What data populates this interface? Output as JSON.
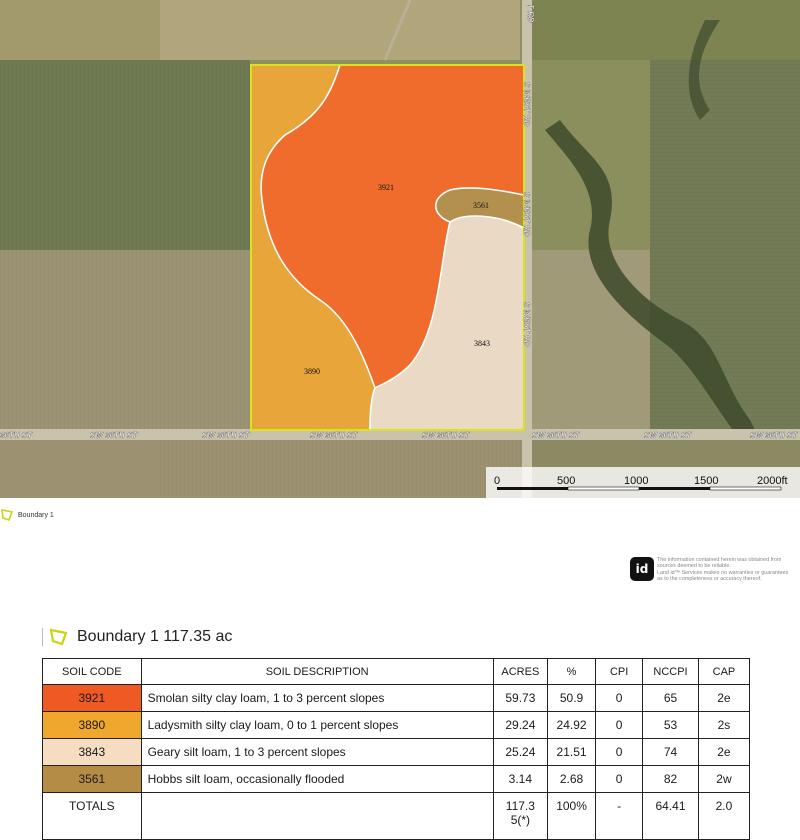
{
  "map": {
    "road_labels": {
      "north_rd": "T RD",
      "west_rd_1": "S WEST RD",
      "west_rd_2": "S WEST RD",
      "west_rd_3": "S WEST RD",
      "st_1": "36TH ST",
      "st_2": "SW 36TH ST",
      "st_3": "SW 36TH ST",
      "st_4": "SW 36TH ST",
      "st_5": "SW 36TH ST",
      "st_6": "SW 36TH ST",
      "st_7": "SW 36TH ST",
      "st_8": "SW 36TH ST"
    },
    "soil_labels": {
      "s3921": "3921",
      "s3561": "3561",
      "s3843": "3843",
      "s3890": "3890"
    },
    "scale": {
      "t0": "0",
      "t500": "500",
      "t1000": "1000",
      "t1500": "1500",
      "t2000": "2000ft"
    },
    "colors": {
      "boundary": "#d9e21a",
      "s3921": "#ef6c2c",
      "s3890": "#e8a53a",
      "s3843": "#ead9c4",
      "s3561": "#b4904f"
    }
  },
  "legend": {
    "label": "Boundary 1"
  },
  "disclaimer": {
    "logo": "id",
    "line1": "The information contained herein was obtained from",
    "line2": "sources deemed to be reliable.",
    "line3": "Land id™ Services makes no warranties or guarantees",
    "line4": "as to the completeness or accuracy thereof."
  },
  "summary": {
    "title": "Boundary 1 117.35 ac"
  },
  "table": {
    "headers": {
      "code": "SOIL CODE",
      "desc": "SOIL DESCRIPTION",
      "acres": "ACRES",
      "pct": "%",
      "cpi": "CPI",
      "nccpi": "NCCPI",
      "cap": "CAP"
    },
    "rows": [
      {
        "code": "3921",
        "color": "#ef5a24",
        "desc": "Smolan silty clay loam, 1 to 3 percent slopes",
        "acres": "59.73",
        "pct": "50.9",
        "cpi": "0",
        "nccpi": "65",
        "cap": "2e"
      },
      {
        "code": "3890",
        "color": "#f0a72e",
        "desc": "Ladysmith silty clay loam, 0 to 1 percent slopes",
        "acres": "29.24",
        "pct": "24.92",
        "cpi": "0",
        "nccpi": "53",
        "cap": "2s"
      },
      {
        "code": "3843",
        "color": "#f6dcc0",
        "desc": "Geary silt loam, 1 to 3 percent slopes",
        "acres": "25.24",
        "pct": "21.51",
        "cpi": "0",
        "nccpi": "74",
        "cap": "2e"
      },
      {
        "code": "3561",
        "color": "#b58c45",
        "desc": "Hobbs silt loam, occasionally flooded",
        "acres": "3.14",
        "pct": "2.68",
        "cpi": "0",
        "nccpi": "82",
        "cap": "2w"
      }
    ],
    "totals": {
      "label": "TOTALS",
      "acres_line1": "117.3",
      "acres_line2": "5(*)",
      "pct": "100%",
      "cpi": "-",
      "nccpi": "64.41",
      "cap": "2.0"
    }
  }
}
